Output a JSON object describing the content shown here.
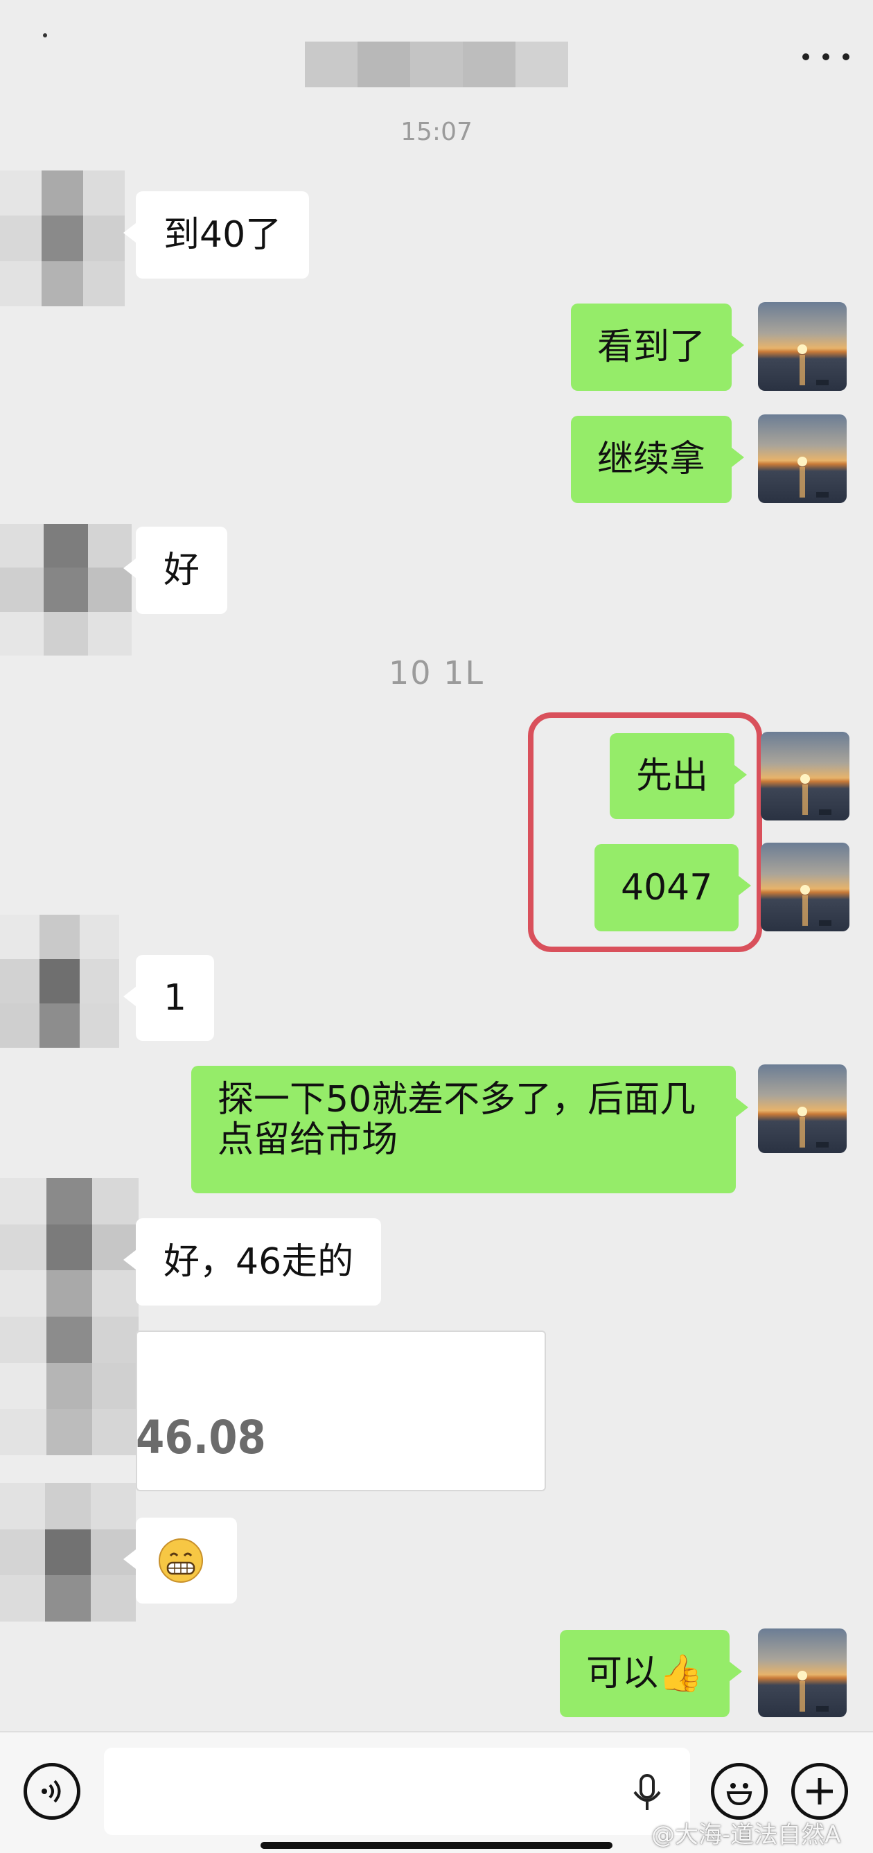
{
  "header": {
    "time": "15:07",
    "menu_icon": "more-icon"
  },
  "messages": [
    {
      "side": "in",
      "text": "到40了"
    },
    {
      "side": "out",
      "text": "看到了"
    },
    {
      "side": "out",
      "text": "继续拿"
    },
    {
      "side": "in",
      "text": "好"
    },
    {
      "side": "out",
      "text": "先出"
    },
    {
      "side": "out",
      "text": "4047"
    },
    {
      "side": "in",
      "text": "1"
    },
    {
      "side": "out",
      "text": "探一下50就差不多了，后面几点留给市场"
    },
    {
      "side": "in",
      "text": "好，46走的"
    },
    {
      "side": "in",
      "text": ""
    },
    {
      "side": "out",
      "text": "可以👍"
    }
  ],
  "partial_timestamp": "10 1L",
  "card": {
    "value": "46.08"
  },
  "input": {
    "placeholder": ""
  },
  "watermark": "@大海-道法自然A",
  "colors": {
    "outgoing": "#95ec69",
    "incoming": "#ffffff",
    "background": "#ededed",
    "highlight": "#d9505b"
  }
}
